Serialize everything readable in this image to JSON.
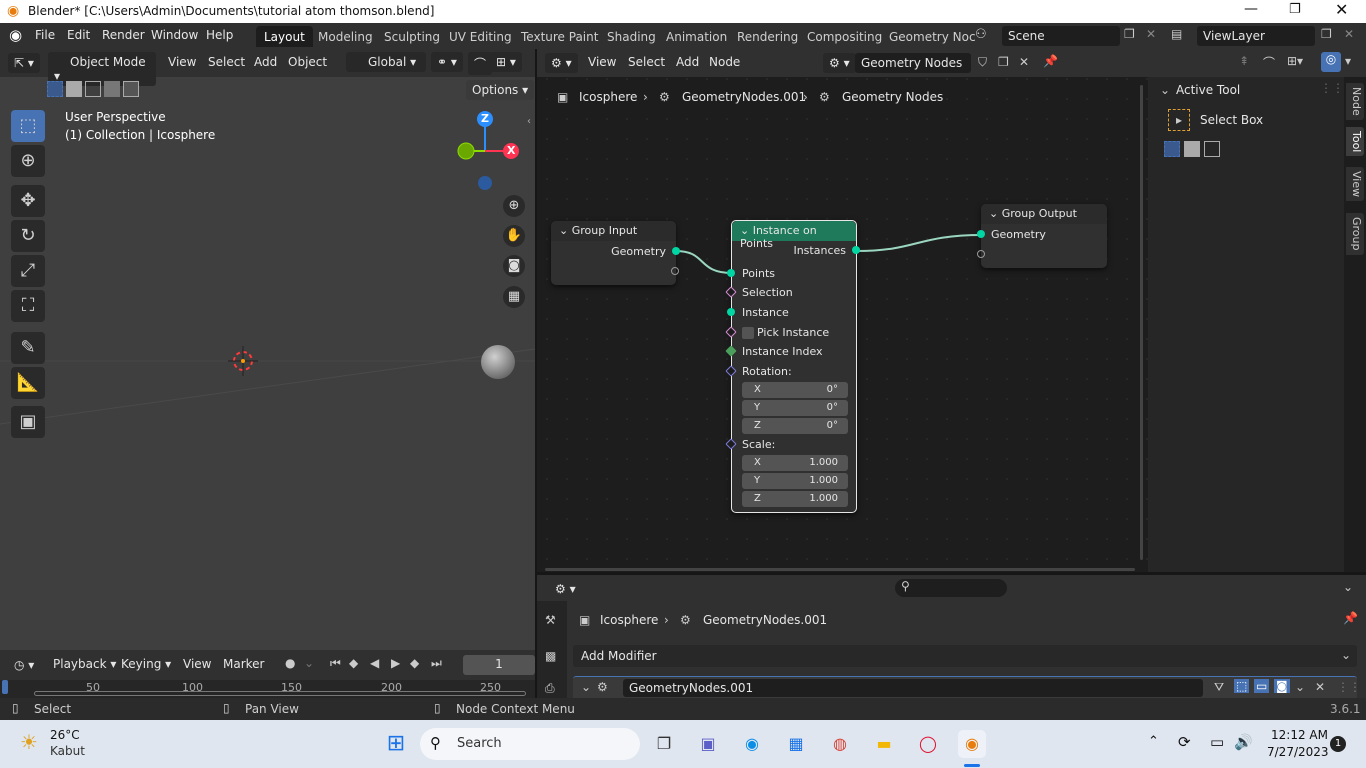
{
  "window": {
    "title": "Blender* [C:\\Users\\Admin\\Documents\\tutorial atom thomson.blend]"
  },
  "menubar": {
    "items": [
      "File",
      "Edit",
      "Render",
      "Window",
      "Help"
    ]
  },
  "workspaces": [
    "Layout",
    "Modeling",
    "Sculpting",
    "UV Editing",
    "Texture Paint",
    "Shading",
    "Animation",
    "Rendering",
    "Compositing",
    "Geometry Noc"
  ],
  "scene": {
    "name": "Scene",
    "viewlayer": "ViewLayer"
  },
  "viewport": {
    "mode": "Object Mode",
    "menus": [
      "View",
      "Select",
      "Add",
      "Object"
    ],
    "orientation": "Global",
    "options": "Options",
    "overlay_title": "User Perspective",
    "overlay_sub": "(1) Collection | Icosphere",
    "axis_z": "Z",
    "axis_x": "X"
  },
  "node_editor": {
    "menus": [
      "View",
      "Select",
      "Add",
      "Node"
    ],
    "tree_name": "Geometry Nodes",
    "breadcrumb": [
      "Icosphere",
      "GeometryNodes.001",
      "Geometry Nodes"
    ]
  },
  "nodes": {
    "group_input": {
      "title": "Group Input",
      "out": "Geometry"
    },
    "instance_on_points": {
      "title": "Instance on Points",
      "out": "Instances",
      "inputs": [
        "Points",
        "Selection",
        "Instance",
        "Pick Instance",
        "Instance Index",
        "Rotation:"
      ],
      "rotation": [
        {
          "axis": "X",
          "value": "0°"
        },
        {
          "axis": "Y",
          "value": "0°"
        },
        {
          "axis": "Z",
          "value": "0°"
        }
      ],
      "scale_label": "Scale:",
      "scale": [
        {
          "axis": "X",
          "value": "1.000"
        },
        {
          "axis": "Y",
          "value": "1.000"
        },
        {
          "axis": "Z",
          "value": "1.000"
        }
      ]
    },
    "group_output": {
      "title": "Group Output",
      "in": "Geometry"
    }
  },
  "sidebar": {
    "section": "Active Tool",
    "tool": "Select Box",
    "tabs": [
      "Node",
      "Tool",
      "View",
      "Group"
    ]
  },
  "properties": {
    "breadcrumb": [
      "Icosphere",
      "GeometryNodes.001"
    ],
    "add_modifier": "Add Modifier",
    "modifier_name": "GeometryNodes.001"
  },
  "timeline": {
    "menus": [
      "Playback",
      "Keying",
      "View",
      "Marker"
    ],
    "frame": "1",
    "ticks": [
      "50",
      "100",
      "150",
      "200",
      "250"
    ]
  },
  "statusbar": {
    "select": "Select",
    "pan": "Pan View",
    "context": "Node Context Menu",
    "version": "3.6.1"
  },
  "taskbar": {
    "weather_temp": "26°C",
    "weather_desc": "Kabut",
    "search": "Search",
    "time": "12:12 AM",
    "date": "7/27/2023",
    "notif": "1"
  },
  "colors": {
    "accent": "#4772b3",
    "geometry_socket": "#00d6a3",
    "node_header_green": "#1f7a5c"
  }
}
